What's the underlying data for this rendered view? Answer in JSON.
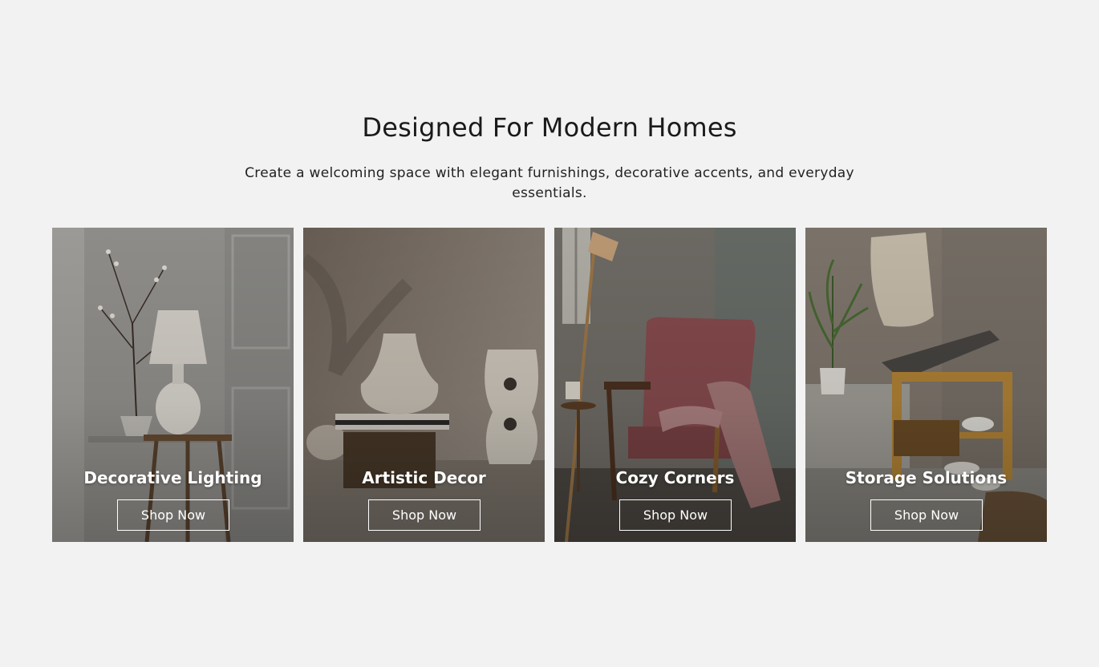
{
  "section": {
    "heading": "Designed For Modern Homes",
    "subtitle": "Create a welcoming space with elegant furnishings, decorative accents, and everyday essentials."
  },
  "cards": [
    {
      "title": "Decorative Lighting",
      "button": "Shop Now",
      "image": "lamp-on-side-table-image"
    },
    {
      "title": "Artistic Decor",
      "button": "Shop Now",
      "image": "ceramic-vases-image"
    },
    {
      "title": "Cozy Corners",
      "button": "Shop Now",
      "image": "pink-armchair-image"
    },
    {
      "title": "Storage Solutions",
      "button": "Shop Now",
      "image": "storage-bench-image"
    }
  ],
  "colors": {
    "background": "#f2f2f2",
    "heading": "#1a1a1a",
    "overlay_text": "#ffffff"
  }
}
